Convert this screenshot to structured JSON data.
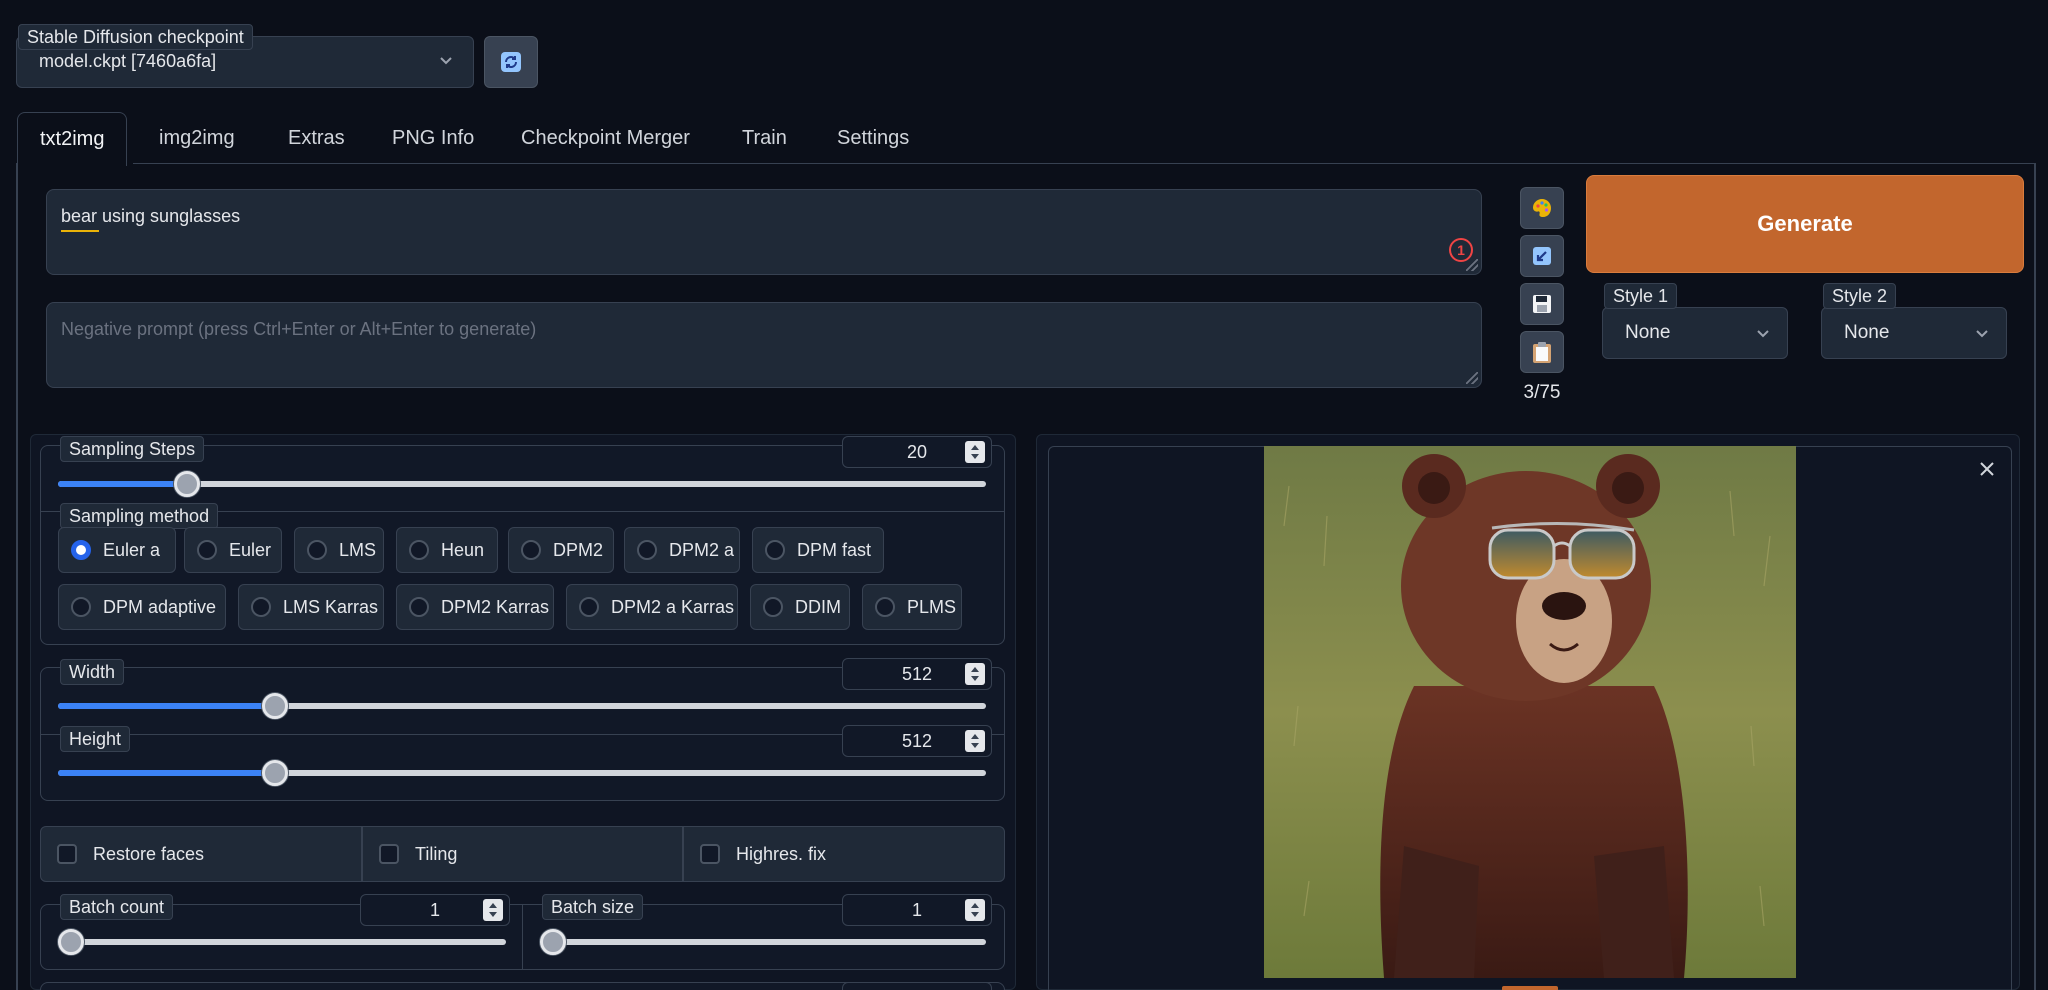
{
  "checkpoint": {
    "label": "Stable Diffusion checkpoint",
    "value": "model.ckpt [7460a6fa]"
  },
  "tabs": [
    {
      "label": "txt2img",
      "active": true
    },
    {
      "label": "img2img"
    },
    {
      "label": "Extras"
    },
    {
      "label": "PNG Info"
    },
    {
      "label": "Checkpoint Merger"
    },
    {
      "label": "Train"
    },
    {
      "label": "Settings"
    }
  ],
  "prompt": {
    "value": "bear using sunglasses",
    "error_badge": "1"
  },
  "negative_prompt": {
    "placeholder": "Negative prompt (press Ctrl+Enter or Alt+Enter to generate)"
  },
  "token_count": "3/75",
  "generate_label": "Generate",
  "styles": [
    {
      "label": "Style 1",
      "value": "None"
    },
    {
      "label": "Style 2",
      "value": "None"
    }
  ],
  "sampling_steps": {
    "label": "Sampling Steps",
    "value": "20",
    "fraction": 0.13
  },
  "sampling_method": {
    "label": "Sampling method",
    "options": [
      "Euler a",
      "Euler",
      "LMS",
      "Heun",
      "DPM2",
      "DPM2 a",
      "DPM fast",
      "DPM adaptive",
      "LMS Karras",
      "DPM2 Karras",
      "DPM2 a Karras",
      "DDIM",
      "PLMS"
    ],
    "selected": "Euler a"
  },
  "width": {
    "label": "Width",
    "value": "512",
    "fraction": 0.23
  },
  "height": {
    "label": "Height",
    "value": "512",
    "fraction": 0.23
  },
  "checkboxes": [
    {
      "label": "Restore faces",
      "checked": false
    },
    {
      "label": "Tiling",
      "checked": false
    },
    {
      "label": "Highres. fix",
      "checked": false
    }
  ],
  "batch_count": {
    "label": "Batch count",
    "value": "1",
    "fraction": 0
  },
  "batch_size": {
    "label": "Batch size",
    "value": "1",
    "fraction": 0
  },
  "colors": {
    "accent": "#c2662d",
    "slider": "#3b82f6",
    "background": "#0b0f19"
  },
  "icons": [
    "refresh-icon",
    "paint-palette-icon",
    "import-arrow-icon",
    "save-icon",
    "clipboard-icon",
    "close-icon",
    "chevron-down-icon"
  ]
}
